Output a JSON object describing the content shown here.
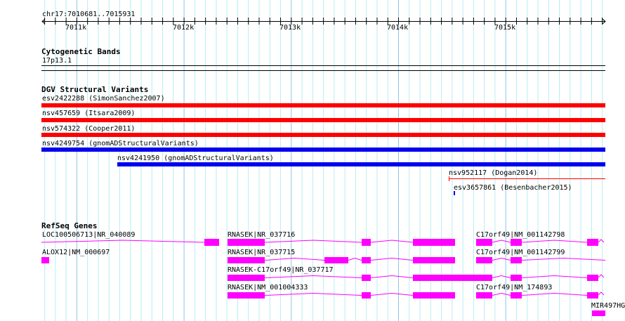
{
  "ruler": {
    "position": "chr17:7010681..7015931",
    "ticks": [
      "7011k",
      "7012k",
      "7013k",
      "7014k",
      "7015k"
    ]
  },
  "cytobands": {
    "title": "Cytogenetic Bands",
    "band": "17p13.1"
  },
  "dgv": {
    "title": "DGV Structural Variants",
    "items": [
      {
        "label": "esv2422288 (SimonSanchez2007)",
        "color": "#ff0000"
      },
      {
        "label": "nsv457659 (Itsara2009)",
        "color": "#ff0000"
      },
      {
        "label": "nsv574322 (Cooper2011)",
        "color": "#ff0000"
      },
      {
        "label": "nsv4249754 (gnomADStructuralVariants)",
        "color": "#0000ee"
      },
      {
        "label": "nsv4241950 (gnomADStructuralVariants)",
        "color": "#0000ee"
      },
      {
        "label": "nsv952117 (Dogan2014)",
        "color": "#ff0000"
      },
      {
        "label": "esv3657861 (Besenbacher2015)",
        "color": "#0000ee"
      }
    ]
  },
  "refseq": {
    "title": "RefSeq Genes",
    "color": "#ff00ff",
    "genes": [
      "LOC100506713|NR_040089",
      "RNASEK|NR_037716",
      "C17orf49|NM_001142798",
      "ALOX12|NM_000697",
      "RNASEK|NR_037715",
      "C17orf49|NM_001142799",
      "RNASEK-C17orf49|NR_037717",
      "RNASEK|NM_001004333",
      "C17orf49|NM_174893",
      "MIR497HG"
    ]
  }
}
